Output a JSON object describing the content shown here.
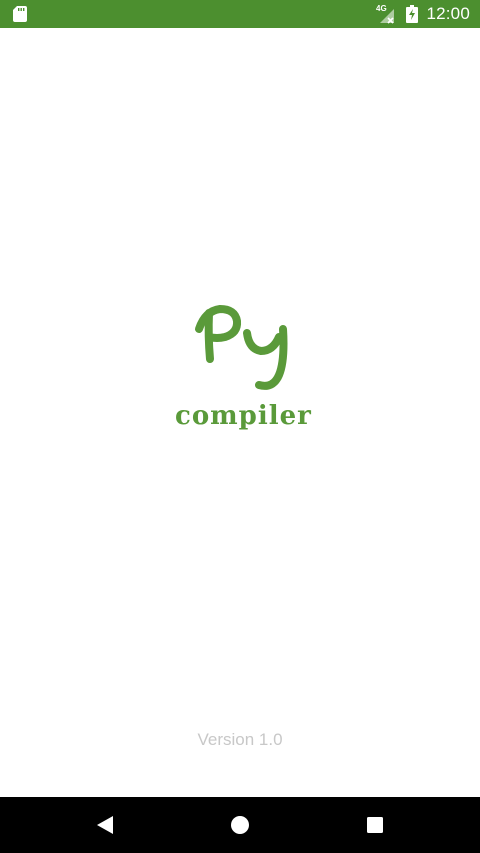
{
  "status_bar": {
    "time": "12:00",
    "network": "4G",
    "background_color": "#4c8f2f",
    "icons": [
      "sd-card-icon",
      "signal-icon",
      "battery-charging-icon"
    ]
  },
  "splash": {
    "logo_text": "Py",
    "logo_subtitle": "compiler",
    "version": "Version 1.0",
    "brand_color": "#5a9a3a"
  },
  "nav_bar": {
    "buttons": [
      "back-icon",
      "home-icon",
      "recents-icon"
    ]
  }
}
